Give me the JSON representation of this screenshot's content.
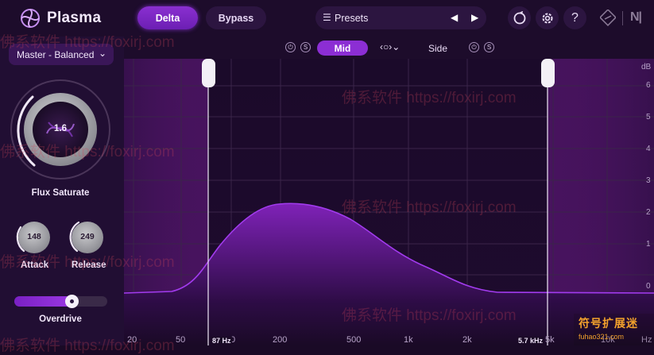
{
  "app": {
    "title": "Plasma"
  },
  "toolbar": {
    "delta_label": "Delta",
    "bypass_label": "Bypass",
    "presets_label": "Presets"
  },
  "left_panel": {
    "preset_value": "Master - Balanced",
    "flux_saturate": {
      "label": "Flux Saturate",
      "value": "1.6"
    },
    "attack": {
      "label": "Attack",
      "value": "148"
    },
    "release": {
      "label": "Release",
      "value": "249"
    },
    "overdrive": {
      "label": "Overdrive",
      "level_percent": 62
    }
  },
  "mode_row": {
    "mid_label": "Mid",
    "side_label": "Side",
    "solo_letter": "S",
    "power_glyph": "⏻"
  },
  "graph": {
    "db_unit": "dB",
    "db_ticks": [
      "6",
      "5",
      "4",
      "3",
      "2",
      "1",
      "0"
    ],
    "hz_ticks": [
      "20",
      "50",
      "0",
      "200",
      "500",
      "1k",
      "2k",
      "5k",
      "10k",
      "Hz"
    ],
    "low_handle_label": "87 Hz",
    "high_handle_label": "5.7 kHz"
  },
  "watermarks": [
    "佛系软件 https://foxirj.com",
    "佛系软件 https://foxirj.com",
    "佛系软件 https://foxirj.com",
    "佛系软件 https://foxirj.com",
    "佛系软件 https://foxirj.com",
    "佛系软件 https://foxirj.com",
    "佛系软件 https://foxirj.com"
  ],
  "badge": {
    "line1": "符号扩展迷",
    "line2": "fuhao321.com"
  },
  "colors": {
    "accent": "#8c2ed4",
    "background": "#1a0a26",
    "curve": "#a23bee"
  }
}
